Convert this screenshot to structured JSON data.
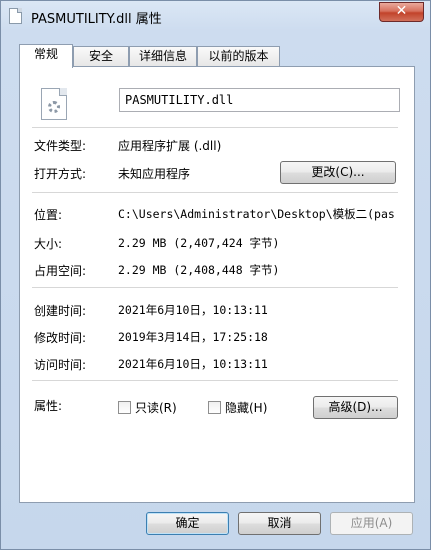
{
  "window": {
    "title": "PASMUTILITY.dll 属性",
    "close_label": "✕"
  },
  "tabs": [
    {
      "label": "常规",
      "active": true
    },
    {
      "label": "安全",
      "active": false
    },
    {
      "label": "详细信息",
      "active": false
    },
    {
      "label": "以前的版本",
      "active": false
    }
  ],
  "general": {
    "file_name": "PASMUTILITY.dll",
    "file_type_label": "文件类型:",
    "file_type_value": "应用程序扩展 (.dll)",
    "opens_with_label": "打开方式:",
    "opens_with_value": "未知应用程序",
    "change_button": "更改(C)...",
    "location_label": "位置:",
    "location_value": "C:\\Users\\Administrator\\Desktop\\模板二(pas",
    "size_label": "大小:",
    "size_value": "2.29 MB (2,407,424 字节)",
    "size_on_disk_label": "占用空间:",
    "size_on_disk_value": "2.29 MB (2,408,448 字节)",
    "created_label": "创建时间:",
    "created_value": "2021年6月10日，10:13:11",
    "modified_label": "修改时间:",
    "modified_value": "2019年3月14日，17:25:18",
    "accessed_label": "访问时间:",
    "accessed_value": "2021年6月10日，10:13:11",
    "attributes_label": "属性:",
    "readonly_label": "只读(R)",
    "hidden_label": "隐藏(H)",
    "advanced_button": "高级(D)..."
  },
  "footer": {
    "ok_button": "确定",
    "cancel_button": "取消",
    "apply_button": "应用(A)"
  }
}
